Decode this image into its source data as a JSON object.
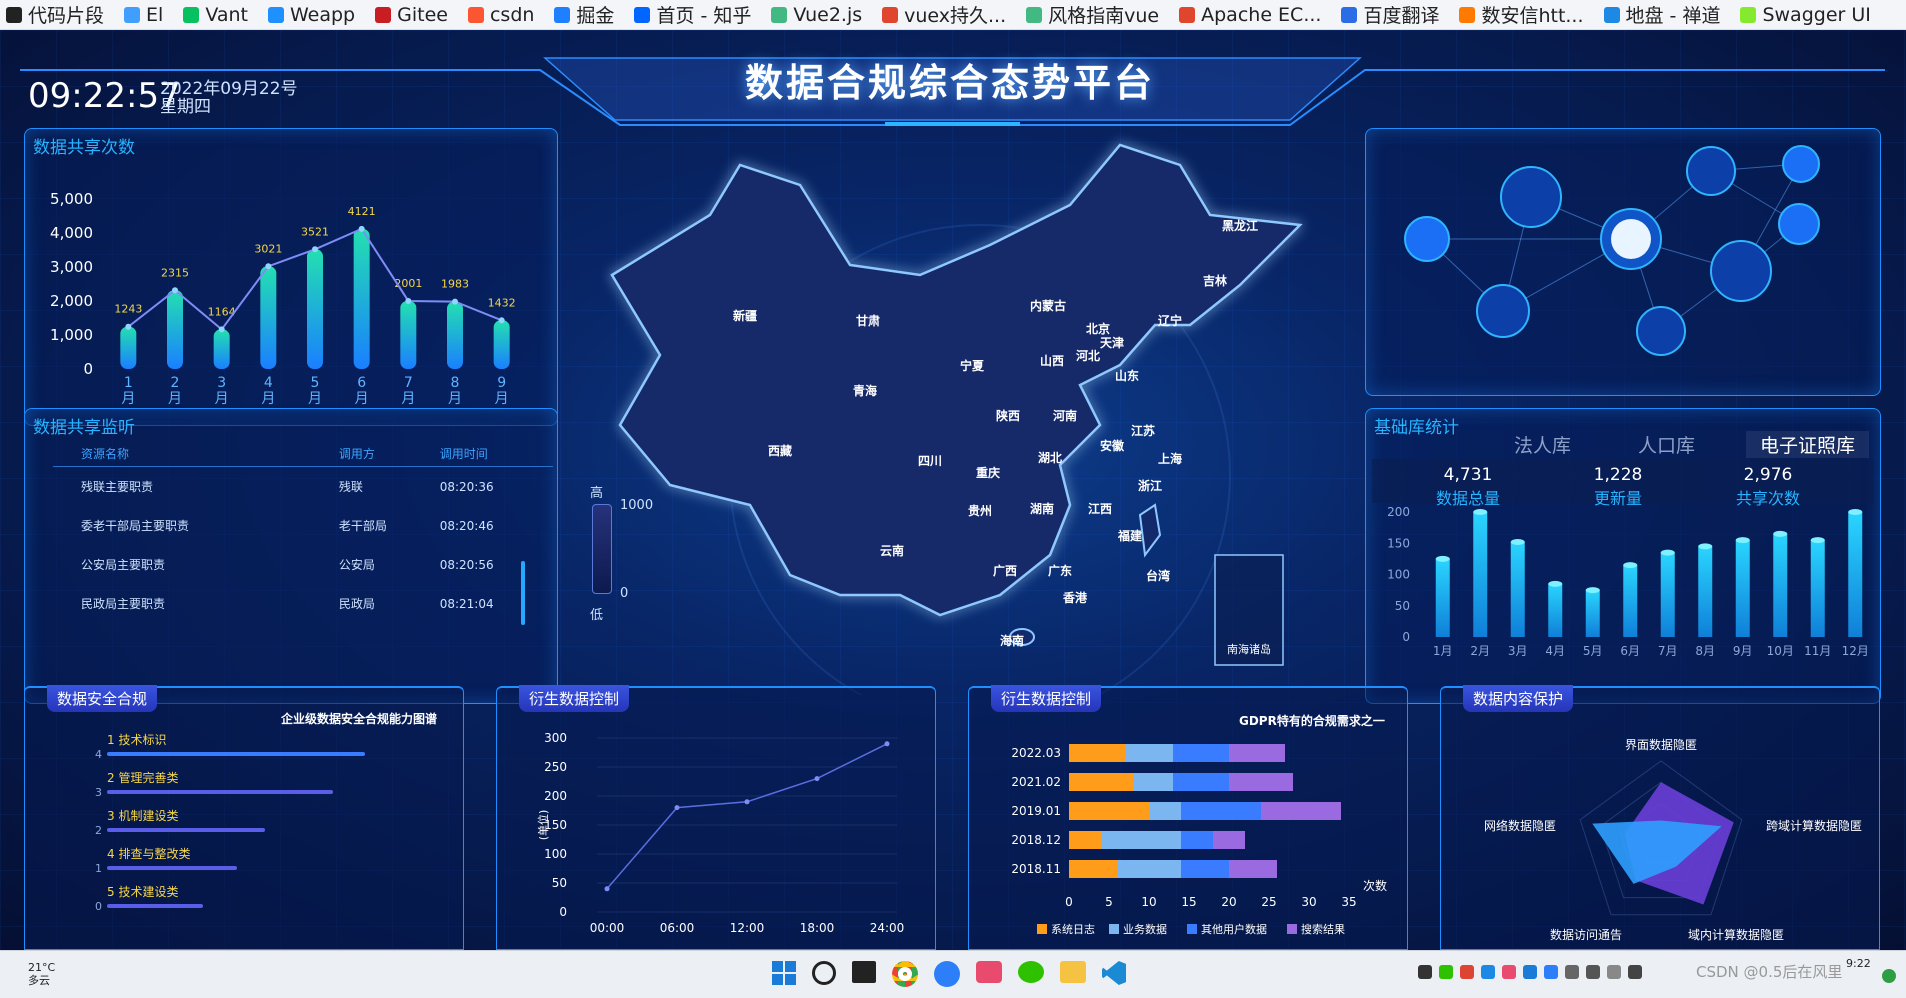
{
  "bookmarks": [
    {
      "label": "代码片段",
      "color": "#222"
    },
    {
      "label": "El",
      "color": "#409eff"
    },
    {
      "label": "Vant",
      "color": "#07c160"
    },
    {
      "label": "Weapp",
      "color": "#1e90ff"
    },
    {
      "label": "Gitee",
      "color": "#c71d23"
    },
    {
      "label": "csdn",
      "color": "#fc5531"
    },
    {
      "label": "掘金",
      "color": "#1e80ff"
    },
    {
      "label": "首页 - 知乎",
      "color": "#0066ff"
    },
    {
      "label": "Vue2.js",
      "color": "#42b883"
    },
    {
      "label": "vuex持久...",
      "color": "#e0452d"
    },
    {
      "label": "风格指南vue",
      "color": "#42b883"
    },
    {
      "label": "Apache EC...",
      "color": "#e0452d"
    },
    {
      "label": "百度翻译",
      "color": "#2b6de5"
    },
    {
      "label": "数安信htt...",
      "color": "#ff7a00"
    },
    {
      "label": "地盘 - 禅道",
      "color": "#1e88e5"
    },
    {
      "label": "Swagger UI",
      "color": "#85ea2d"
    }
  ],
  "header": {
    "title": "数据合规综合态势平台",
    "time": "09:22:57",
    "date": "2022年09月22号",
    "weekday": "星期四"
  },
  "share_count": {
    "title": "数据共享次数"
  },
  "monitor": {
    "title": "数据共享监听",
    "headers": [
      "资源名称",
      "调用方",
      "调用时间"
    ],
    "rows": [
      [
        "残联主要职责",
        "残联",
        "08:20:36"
      ],
      [
        "委老干部局主要职责",
        "老干部局",
        "08:20:46"
      ],
      [
        "公安局主要职责",
        "公安局",
        "08:20:56"
      ],
      [
        "民政局主要职责",
        "民政局",
        "08:21:04"
      ]
    ]
  },
  "legend": {
    "high": "高",
    "low": "低",
    "max": "1000",
    "min": "0"
  },
  "map": {
    "provinces": [
      {
        "name": "新疆"
      },
      {
        "name": "西藏"
      },
      {
        "name": "青海"
      },
      {
        "name": "甘肃"
      },
      {
        "name": "内蒙古"
      },
      {
        "name": "黑龙江"
      },
      {
        "name": "吉林"
      },
      {
        "name": "辽宁"
      },
      {
        "name": "北京"
      },
      {
        "name": "天津"
      },
      {
        "name": "河北"
      },
      {
        "name": "山西"
      },
      {
        "name": "宁夏"
      },
      {
        "name": "陕西"
      },
      {
        "name": "山东"
      },
      {
        "name": "河南"
      },
      {
        "name": "江苏"
      },
      {
        "name": "安徽"
      },
      {
        "name": "上海"
      },
      {
        "name": "四川"
      },
      {
        "name": "重庆"
      },
      {
        "name": "湖北"
      },
      {
        "name": "浙江"
      },
      {
        "name": "贵州"
      },
      {
        "name": "湖南"
      },
      {
        "name": "江西"
      },
      {
        "name": "福建"
      },
      {
        "name": "云南"
      },
      {
        "name": "广西"
      },
      {
        "name": "广东"
      },
      {
        "name": "台湾"
      },
      {
        "name": "香港"
      },
      {
        "name": "海南"
      }
    ],
    "inset": "南海诸岛"
  },
  "base": {
    "title": "基础库统计",
    "tabs": [
      "法人库",
      "人口库",
      "电子证照库"
    ],
    "stats": [
      {
        "value": "4,731",
        "label": "数据总量"
      },
      {
        "value": "1,228",
        "label": "更新量"
      },
      {
        "value": "2,976",
        "label": "共享次数"
      }
    ]
  },
  "security": {
    "tag": "数据安全合规",
    "subtitle": "企业级数据安全合规能力图谱",
    "items": [
      {
        "label": "1 技术标识",
        "value": 4
      },
      {
        "label": "2 管理完善类",
        "value": 3
      },
      {
        "label": "3 机制建设类",
        "value": 2
      },
      {
        "label": "4 排查与整改类",
        "value": 1
      },
      {
        "label": "5 技术建设类",
        "value": 0
      }
    ]
  },
  "derived1": {
    "tag": "衍生数据控制"
  },
  "derived2": {
    "tag": "衍生数据控制",
    "subtitle": "GDPR特有的合规需求之一"
  },
  "protection": {
    "tag": "数据内容保护"
  },
  "taskbar": {
    "weather_temp": "21°C",
    "weather_text": "多云",
    "time": "9:22",
    "watermark": "CSDN @0.5后在风里"
  },
  "chart_data": [
    {
      "type": "bar",
      "title": "数据共享次数",
      "categories": [
        "1月",
        "2月",
        "3月",
        "4月",
        "5月",
        "6月",
        "7月",
        "8月",
        "9月"
      ],
      "values": [
        1243,
        2315,
        1164,
        3021,
        3521,
        4121,
        2001,
        1983,
        1432
      ],
      "ylim": [
        0,
        5000
      ],
      "yticks": [
        0,
        1000,
        2000,
        3000,
        4000,
        5000
      ],
      "ytick_labels": [
        "0",
        "1,000",
        "2,000",
        "3,000",
        "4,000",
        "5,000"
      ],
      "colors": [
        "#23e0b0",
        "#1a7fff"
      ]
    },
    {
      "type": "bar",
      "title": "基础库统计",
      "categories": [
        "1月",
        "2月",
        "3月",
        "4月",
        "5月",
        "6月",
        "7月",
        "8月",
        "9月",
        "10月",
        "11月",
        "12月"
      ],
      "values": [
        125,
        200,
        152,
        85,
        75,
        115,
        135,
        145,
        155,
        165,
        155,
        200
      ],
      "ylim": [
        0,
        200
      ],
      "yticks": [
        0,
        50,
        100,
        150,
        200
      ]
    },
    {
      "type": "bar",
      "title": "企业级数据安全合规能力图谱",
      "categories": [
        "技术标识",
        "管理完善类",
        "机制建设类",
        "排查与整改类",
        "技术建设类"
      ],
      "values": [
        4,
        3,
        2,
        1,
        0
      ]
    },
    {
      "type": "line",
      "title": "衍生数据控制",
      "x": [
        "00:00",
        "06:00",
        "12:00",
        "18:00",
        "24:00"
      ],
      "y": [
        40,
        180,
        190,
        230,
        290
      ],
      "ylim": [
        0,
        300
      ],
      "yticks": [
        0,
        50,
        100,
        150,
        200,
        250,
        300
      ]
    },
    {
      "type": "bar",
      "title": "GDPR特有的合规需求之一",
      "categories": [
        "2022.03",
        "2021.02",
        "2019.01",
        "2018.12",
        "2018.11"
      ],
      "xlabel": "次数",
      "xlim": [
        0,
        35
      ],
      "xticks": [
        0,
        5,
        10,
        15,
        20,
        25,
        30,
        35
      ],
      "series": [
        {
          "name": "系统日志",
          "values": [
            7,
            8,
            10,
            4,
            6
          ],
          "color": "#ff9c1a"
        },
        {
          "name": "业务数据",
          "values": [
            6,
            5,
            4,
            10,
            8
          ],
          "color": "#7cb6f0"
        },
        {
          "name": "其他用户数据",
          "values": [
            7,
            7,
            10,
            4,
            6
          ],
          "color": "#3a7cff"
        },
        {
          "name": "搜索结果",
          "values": [
            7,
            8,
            10,
            4,
            6
          ],
          "color": "#9a6be0"
        }
      ]
    },
    {
      "type": "radar",
      "title": "数据内容保护",
      "indicators": [
        "界面数据隐匿",
        "跨域计算数据隐匿",
        "域内计算数据隐匿",
        "数据访问通告",
        "网络数据隐匿"
      ],
      "series": [
        {
          "values": [
            0.75,
            0.9,
            0.85,
            0.5,
            0.45
          ],
          "color": "#6a3fd8"
        },
        {
          "values": [
            0.3,
            0.75,
            0.3,
            0.55,
            0.85
          ],
          "color": "#2fa0ff"
        }
      ]
    }
  ]
}
